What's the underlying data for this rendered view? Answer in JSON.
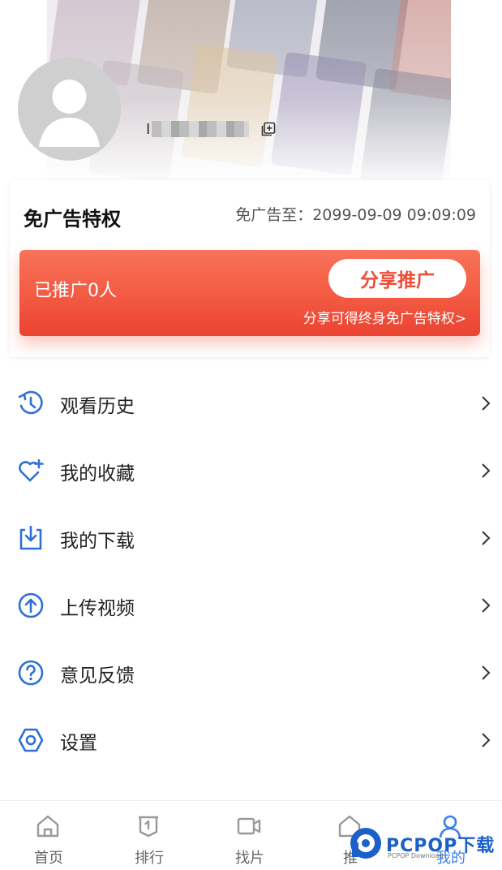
{
  "profile": {
    "username_initial": "I",
    "avatar_icon": "user-avatar-icon",
    "copy_icon": "copy-icon"
  },
  "vip": {
    "title": "免广告特权",
    "expire_text": "免广告至：2099-09-09 09:09:09",
    "promoted_count_text": "已推广0人",
    "share_button": "分享推广",
    "share_tip": "分享可得终身免广告特权>"
  },
  "menu": {
    "items": [
      {
        "label": "观看历史",
        "icon": "history-icon"
      },
      {
        "label": "我的收藏",
        "icon": "favorite-heart-icon"
      },
      {
        "label": "我的下载",
        "icon": "download-icon"
      },
      {
        "label": "上传视频",
        "icon": "upload-icon"
      },
      {
        "label": "意见反馈",
        "icon": "feedback-question-icon"
      },
      {
        "label": "设置",
        "icon": "settings-icon"
      }
    ]
  },
  "tabbar": {
    "items": [
      {
        "label": "首页",
        "icon": "home-icon"
      },
      {
        "label": "排行",
        "icon": "ranking-icon"
      },
      {
        "label": "找片",
        "icon": "video-camera-icon"
      },
      {
        "label": "推",
        "icon": "recommend-icon"
      },
      {
        "label": "我的",
        "icon": "user-icon",
        "active": true
      }
    ]
  },
  "watermark": {
    "brand": "PCPOP下载",
    "sub": "PCPOP Download"
  },
  "colors": {
    "accent_blue": "#2f6fd8",
    "promo_red": "#f35a42",
    "active_tab": "#3a7ff0"
  }
}
